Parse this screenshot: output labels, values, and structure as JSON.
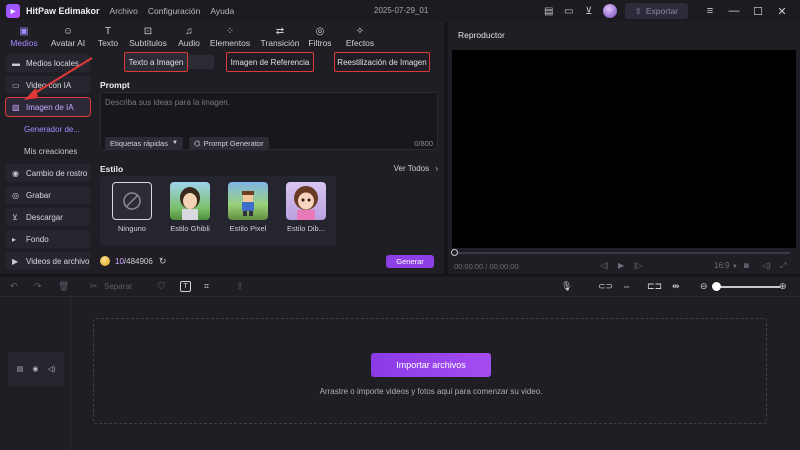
{
  "titlebar": {
    "app_name": "HitPaw Edimakor",
    "menu": [
      "Archivo",
      "Configuración",
      "Ayuda"
    ],
    "project_title": "2025-07-29_01",
    "export_label": "Exportar"
  },
  "tabs": [
    {
      "label": "Medios",
      "icon": "media-icon",
      "glyph": "▣",
      "active": true
    },
    {
      "label": "Avatar AI",
      "icon": "avatar-icon",
      "glyph": "☺",
      "active": false
    },
    {
      "label": "Texto",
      "icon": "text-icon",
      "glyph": "T",
      "active": false
    },
    {
      "label": "Subtítulos",
      "icon": "subtitles-icon",
      "glyph": "⊡",
      "active": false
    },
    {
      "label": "Audio",
      "icon": "audio-icon",
      "glyph": "♫",
      "active": false
    },
    {
      "label": "Elementos",
      "icon": "elements-icon",
      "glyph": "⁘",
      "active": false
    },
    {
      "label": "Transición",
      "icon": "transition-icon",
      "glyph": "⇄",
      "active": false
    },
    {
      "label": "Filtros",
      "icon": "filters-icon",
      "glyph": "◎",
      "active": false
    },
    {
      "label": "Efectos",
      "icon": "effects-icon",
      "glyph": "✧",
      "active": false
    }
  ],
  "sidebar": {
    "items": [
      {
        "label": "Medios locales",
        "icon": "folder-icon",
        "glyph": "▬"
      },
      {
        "label": "Video con IA",
        "icon": "ai-video-icon",
        "glyph": "▭"
      },
      {
        "label": "Imagen de IA",
        "icon": "ai-image-icon",
        "glyph": "▨"
      }
    ],
    "sub_items": [
      "Generador de...",
      "Mis creaciones"
    ],
    "more_items": [
      {
        "label": "Cambio de rostro",
        "icon": "face-swap-icon",
        "glyph": "◉"
      },
      {
        "label": "Grabar",
        "icon": "record-icon",
        "glyph": "◎"
      },
      {
        "label": "Descargar",
        "icon": "download-icon",
        "glyph": "⊻"
      },
      {
        "label": "Fondo",
        "icon": "background-icon",
        "glyph": "▸"
      },
      {
        "label": "Videos de archivo",
        "icon": "stock-video-icon",
        "glyph": "▶"
      }
    ]
  },
  "subtabs": [
    "Texto a Imagen",
    "Imagen de Referencia",
    "Reestilización de Imagen"
  ],
  "prompt": {
    "label": "Prompt",
    "placeholder": "Describa sus ideas para la imagen.",
    "quick_tags": "Etiquetas rápidas",
    "generator": "Prompt Generator",
    "counter": "0/800"
  },
  "style": {
    "label": "Estilo",
    "see_all": "Ver Todos",
    "options": [
      "Ninguno",
      "Estilo Ghibli",
      "Estilo Pixel",
      "Estilo Dib..."
    ]
  },
  "credits": {
    "used": "10",
    "total": "/484906"
  },
  "generate_label": "Generar",
  "player": {
    "title": "Reproductor",
    "time": "00:00:00 / 00:00:00",
    "ratio": "16:9"
  },
  "timeline": {
    "split_label": "Separar",
    "import_label": "Importar archivos",
    "drop_hint": "Arrastre o importe videos y fotos aquí para comenzar su video."
  },
  "colors": {
    "accent": "#8d3fe6",
    "highlight": "#e03838"
  }
}
